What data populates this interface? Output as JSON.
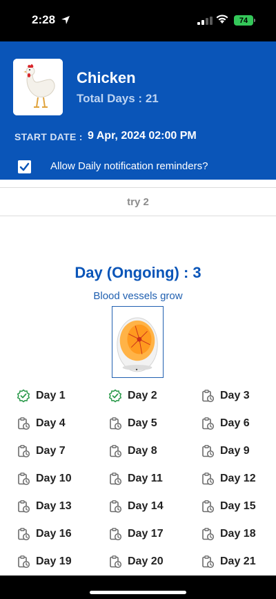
{
  "status": {
    "time": "2:28",
    "battery": "74"
  },
  "header": {
    "species": "Chicken",
    "total_days_label": "Total Days : 21",
    "start_label": "START DATE :",
    "start_value": "9 Apr, 2024 02:00 PM",
    "notification_label": "Allow Daily notification reminders?",
    "notification_checked": true
  },
  "tab": {
    "label": "try 2"
  },
  "current_day": {
    "title": "Day (Ongoing) : 3",
    "description": "Blood vessels grow"
  },
  "days": [
    {
      "label": "Day 1",
      "status": "done"
    },
    {
      "label": "Day 2",
      "status": "done"
    },
    {
      "label": "Day 3",
      "status": "pending"
    },
    {
      "label": "Day 4",
      "status": "pending"
    },
    {
      "label": "Day 5",
      "status": "pending"
    },
    {
      "label": "Day 6",
      "status": "pending"
    },
    {
      "label": "Day 7",
      "status": "pending"
    },
    {
      "label": "Day 8",
      "status": "pending"
    },
    {
      "label": "Day 9",
      "status": "pending"
    },
    {
      "label": "Day 10",
      "status": "pending"
    },
    {
      "label": "Day 11",
      "status": "pending"
    },
    {
      "label": "Day 12",
      "status": "pending"
    },
    {
      "label": "Day 13",
      "status": "pending"
    },
    {
      "label": "Day 14",
      "status": "pending"
    },
    {
      "label": "Day 15",
      "status": "pending"
    },
    {
      "label": "Day 16",
      "status": "pending"
    },
    {
      "label": "Day 17",
      "status": "pending"
    },
    {
      "label": "Day 18",
      "status": "pending"
    },
    {
      "label": "Day 19",
      "status": "pending"
    },
    {
      "label": "Day 20",
      "status": "pending"
    },
    {
      "label": "Day 21",
      "status": "pending"
    }
  ],
  "colors": {
    "primary": "#0a55b8",
    "done": "#2e9b4d",
    "pending_icon": "#6b6b6b"
  }
}
